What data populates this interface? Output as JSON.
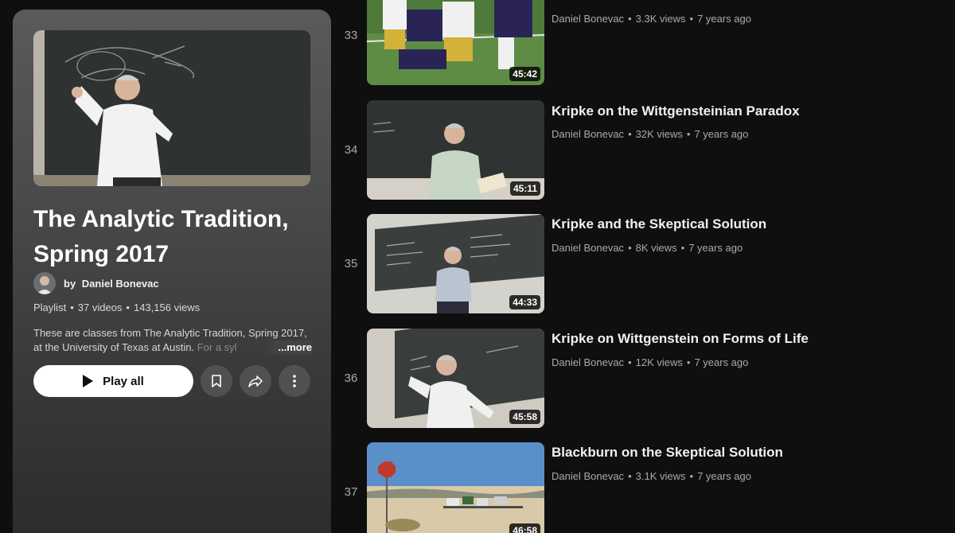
{
  "playlist": {
    "title_line1": "The Analytic Tradition,",
    "title_line2": "Spring 2017",
    "owner_prefix": "by",
    "owner": "Daniel Bonevac",
    "type": "Playlist",
    "video_count": "37 videos",
    "views": "143,156 views",
    "description": "These are classes from The Analytic Tradition, Spring 2017, at the University of Texas at Austin.",
    "description_fade": " For a syl",
    "more_label": "...more",
    "play_all_label": "Play all",
    "icons": {
      "save": "bookmark-icon",
      "share": "share-icon",
      "more": "more-vertical-icon"
    }
  },
  "videos": [
    {
      "index": "33",
      "title": "",
      "channel": "Daniel Bonevac",
      "views": "3.3K views",
      "age": "7 years ago",
      "duration": "45:42",
      "thumb": "football"
    },
    {
      "index": "34",
      "title": "Kripke on the Wittgensteinian Paradox",
      "channel": "Daniel Bonevac",
      "views": "32K views",
      "age": "7 years ago",
      "duration": "45:11",
      "thumb": "lecture-book"
    },
    {
      "index": "35",
      "title": "Kripke and the Skeptical Solution",
      "channel": "Daniel Bonevac",
      "views": "8K views",
      "age": "7 years ago",
      "duration": "44:33",
      "thumb": "lecture-board"
    },
    {
      "index": "36",
      "title": "Kripke on Wittgenstein on Forms of Life",
      "channel": "Daniel Bonevac",
      "views": "12K views",
      "age": "7 years ago",
      "duration": "45:58",
      "thumb": "lecture-gesture"
    },
    {
      "index": "37",
      "title": "Blackburn on the Skeptical Solution",
      "channel": "Daniel Bonevac",
      "views": "3.1K views",
      "age": "7 years ago",
      "duration": "46:58",
      "thumb": "desert-stop"
    }
  ],
  "colors": {
    "background": "#0f0f0f",
    "text_primary": "#f1f1f1",
    "text_secondary": "#aaaaaa",
    "button_white": "#ffffff"
  }
}
